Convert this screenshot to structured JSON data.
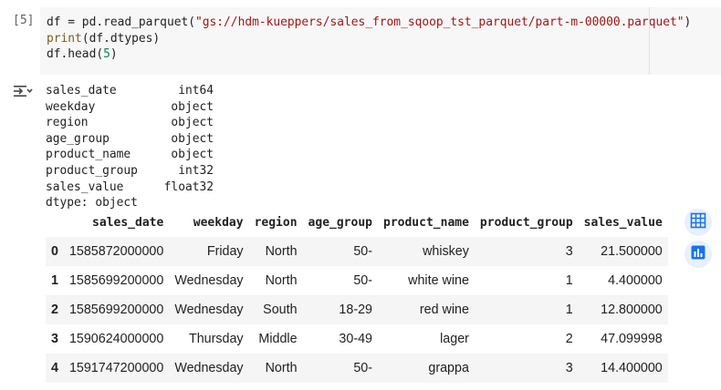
{
  "cell": {
    "execution_count": "[5]",
    "code_lines": [
      {
        "parts": [
          {
            "text": "df = pd.",
            "cls": ""
          },
          {
            "text": "read_parquet",
            "cls": ""
          },
          {
            "text": "(",
            "cls": ""
          },
          {
            "text": "\"gs://hdm-kueppers/sales_from_sqoop_tst_parquet/part-m-00000.parquet\"",
            "cls": "str"
          },
          {
            "text": ")",
            "cls": ""
          }
        ]
      },
      {
        "parts": [
          {
            "text": "print",
            "cls": "fn"
          },
          {
            "text": "(df.dtypes)",
            "cls": ""
          }
        ]
      },
      {
        "parts": [
          {
            "text": "df.head(",
            "cls": ""
          },
          {
            "text": "5",
            "cls": "num"
          },
          {
            "text": ")",
            "cls": ""
          }
        ]
      }
    ]
  },
  "output": {
    "icon": "output-toggle-icon",
    "dtypes": [
      {
        "name": "sales_date",
        "type": "int64"
      },
      {
        "name": "weekday",
        "type": "object"
      },
      {
        "name": "region",
        "type": "object"
      },
      {
        "name": "age_group",
        "type": "object"
      },
      {
        "name": "product_name",
        "type": "object"
      },
      {
        "name": "product_group",
        "type": "int32"
      },
      {
        "name": "sales_value",
        "type": "float32"
      }
    ],
    "dtype_footer": "dtype: object",
    "table": {
      "columns": [
        "",
        "sales_date",
        "weekday",
        "region",
        "age_group",
        "product_name",
        "product_group",
        "sales_value"
      ],
      "rows": [
        [
          "0",
          "1585872000000",
          "Friday",
          "North",
          "50-",
          "whiskey",
          "3",
          "21.500000"
        ],
        [
          "1",
          "1585699200000",
          "Wednesday",
          "North",
          "50-",
          "white wine",
          "1",
          "4.400000"
        ],
        [
          "2",
          "1585699200000",
          "Wednesday",
          "South",
          "18-29",
          "red wine",
          "1",
          "12.800000"
        ],
        [
          "3",
          "1590624000000",
          "Thursday",
          "Middle",
          "30-49",
          "lager",
          "2",
          "47.099998"
        ],
        [
          "4",
          "1591747200000",
          "Wednesday",
          "North",
          "50-",
          "grappa",
          "3",
          "14.400000"
        ]
      ]
    },
    "side_buttons": [
      {
        "name": "table-view-button",
        "icon": "table-icon"
      },
      {
        "name": "chart-suggest-button",
        "icon": "bar-chart-icon"
      }
    ]
  },
  "colors": {
    "code_background": "#f7f7f7",
    "string": "#a31515",
    "function": "#795e26",
    "number": "#098658",
    "accent": "#1a73e8",
    "stripe": "#f5f5f5"
  }
}
